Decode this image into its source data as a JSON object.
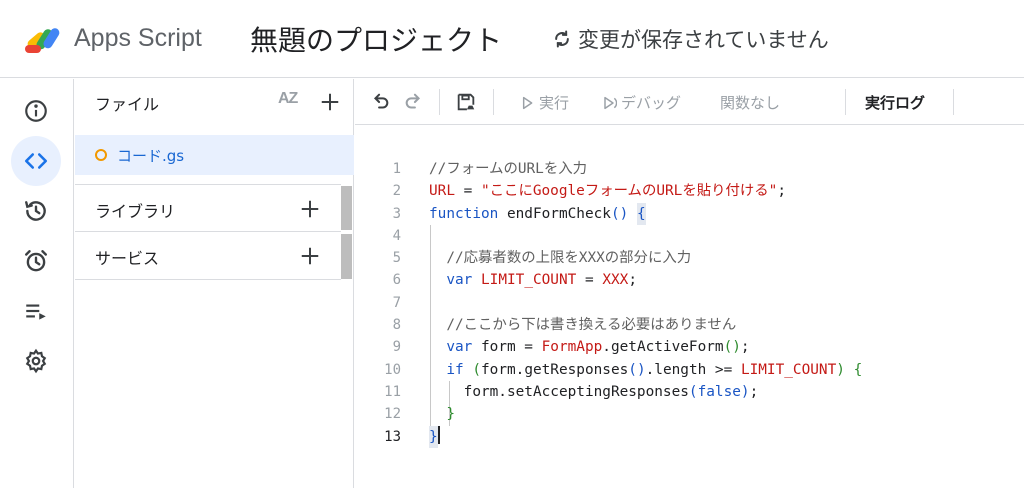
{
  "header": {
    "app_name": "Apps Script",
    "project_title": "無題のプロジェクト",
    "save_status": "変更が保存されていません"
  },
  "rail": {
    "items": [
      {
        "icon": "info-icon",
        "active": false
      },
      {
        "icon": "code-icon",
        "active": true
      },
      {
        "icon": "history-icon",
        "active": false
      },
      {
        "icon": "alarm-icon",
        "active": false
      },
      {
        "icon": "executions-icon",
        "active": false
      },
      {
        "icon": "gear-icon",
        "active": false
      }
    ]
  },
  "panel": {
    "files_title": "ファイル",
    "sort_label": "AZ",
    "file_name": "コード.gs",
    "libraries_label": "ライブラリ",
    "services_label": "サービス"
  },
  "toolbar": {
    "run_label": "実行",
    "debug_label": "デバッグ",
    "function_label": "関数なし",
    "log_label": "実行ログ"
  },
  "editor": {
    "current_line": 13,
    "line_numbers": [
      "1",
      "2",
      "3",
      "4",
      "5",
      "6",
      "7",
      "8",
      "9",
      "10",
      "11",
      "12",
      "13"
    ]
  },
  "colors": {
    "accent": "#1a73e8",
    "active_bg": "#e8f0fe",
    "file_dot": "#f29900",
    "keyword": "#1a55c4",
    "string": "#c41a16"
  }
}
